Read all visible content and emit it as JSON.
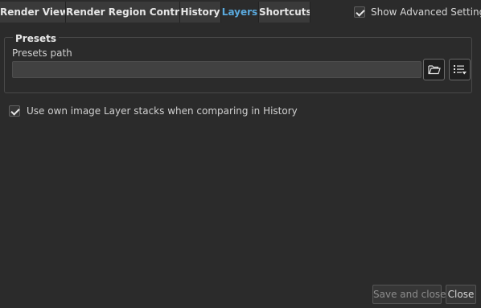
{
  "tabs": [
    {
      "label": "Render View"
    },
    {
      "label": "Render Region Controls"
    },
    {
      "label": "History"
    },
    {
      "label": "Layers"
    },
    {
      "label": "Shortcuts"
    }
  ],
  "active_tab": "Layers",
  "show_advanced": {
    "label": "Show Advanced Settings",
    "checked": true
  },
  "presets": {
    "group_title": "Presets",
    "path_label": "Presets path",
    "path_value": "",
    "icons": {
      "browse": "folder-open-icon",
      "menu": "list-dropdown-icon"
    }
  },
  "own_stacks": {
    "label": "Use own image Layer stacks when comparing in History",
    "checked": true
  },
  "footer": {
    "save_label": "Save and close",
    "close_label": "Close"
  },
  "colors": {
    "background": "#2b2b2b",
    "tab": "#3a3a3a",
    "active_tab_text": "#5aa9dd"
  }
}
